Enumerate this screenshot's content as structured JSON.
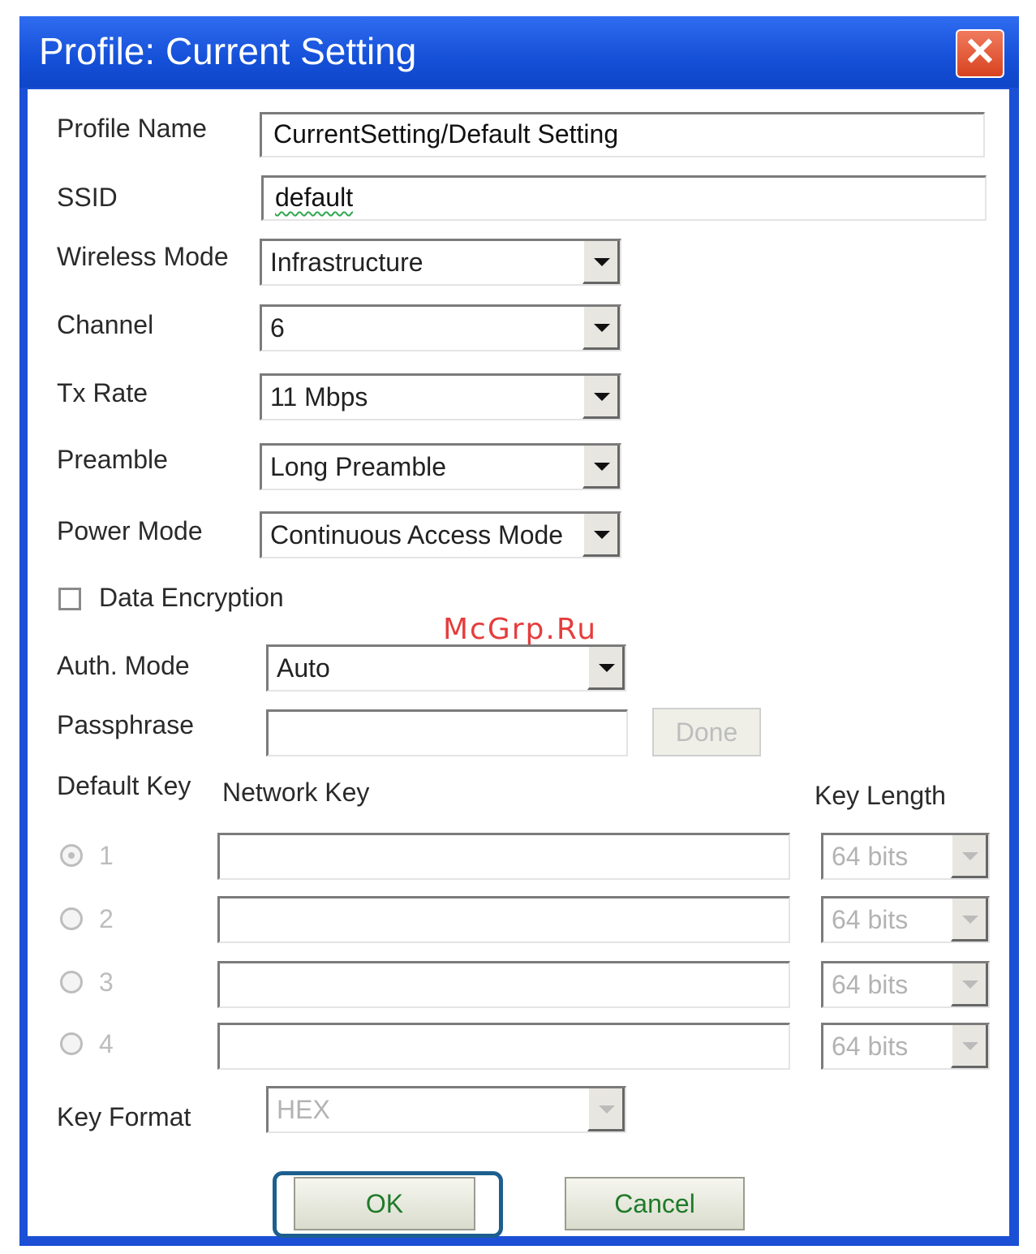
{
  "window": {
    "title": "Profile: Current Setting",
    "close_label": "✕"
  },
  "fields": {
    "profile_name": {
      "label": "Profile Name",
      "value": "CurrentSetting/Default Setting"
    },
    "ssid": {
      "label": "SSID",
      "value": "default"
    },
    "wireless_mode": {
      "label": "Wireless Mode",
      "value": "Infrastructure"
    },
    "channel": {
      "label": "Channel",
      "value": "6"
    },
    "tx_rate": {
      "label": "Tx Rate",
      "value": "11 Mbps"
    },
    "preamble": {
      "label": "Preamble",
      "value": "Long Preamble"
    },
    "power_mode": {
      "label": "Power Mode",
      "value": "Continuous Access Mode"
    }
  },
  "encryption": {
    "checkbox_label": "Data Encryption",
    "checked": false,
    "auth_mode": {
      "label": "Auth. Mode",
      "value": "Auto"
    },
    "passphrase": {
      "label": "Passphrase",
      "value": ""
    },
    "done_label": "Done"
  },
  "keys": {
    "default_key_label": "Default Key",
    "network_key_label": "Network Key",
    "key_length_label": "Key Length",
    "rows": [
      {
        "index": "1",
        "selected": true,
        "length": "64 bits"
      },
      {
        "index": "2",
        "selected": false,
        "length": "64 bits"
      },
      {
        "index": "3",
        "selected": false,
        "length": "64 bits"
      },
      {
        "index": "4",
        "selected": false,
        "length": "64 bits"
      }
    ],
    "key_format": {
      "label": "Key Format",
      "value": "HEX"
    }
  },
  "buttons": {
    "ok": "OK",
    "cancel": "Cancel"
  },
  "watermark": "McGrp.Ru"
}
